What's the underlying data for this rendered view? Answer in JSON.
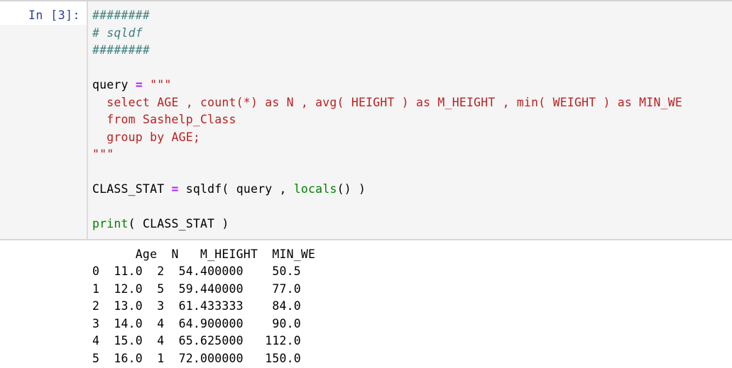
{
  "cell": {
    "prompt_label": "In [3]:",
    "execution_count": 3,
    "input_background": "#f5f5f5",
    "prompt_color": "#303f9f",
    "code_lines": [
      {
        "tokens": [
          {
            "text": "########",
            "type": "comment"
          }
        ]
      },
      {
        "tokens": [
          {
            "text": "# sqldf",
            "type": "comment"
          }
        ]
      },
      {
        "tokens": [
          {
            "text": "########",
            "type": "comment"
          }
        ]
      },
      {
        "tokens": []
      },
      {
        "tokens": [
          {
            "text": "query ",
            "type": "name"
          },
          {
            "text": "=",
            "type": "op"
          },
          {
            "text": " ",
            "type": "name"
          },
          {
            "text": "\"\"\"",
            "type": "string"
          }
        ]
      },
      {
        "tokens": [
          {
            "text": "  select AGE , count(*) as N , avg( HEIGHT ) as M_HEIGHT , min( WEIGHT ) as MIN_WE",
            "type": "string"
          }
        ]
      },
      {
        "tokens": [
          {
            "text": "  from Sashelp_Class",
            "type": "string"
          }
        ]
      },
      {
        "tokens": [
          {
            "text": "  group by AGE;",
            "type": "string"
          }
        ]
      },
      {
        "tokens": [
          {
            "text": "\"\"\"",
            "type": "string"
          }
        ]
      },
      {
        "tokens": []
      },
      {
        "tokens": [
          {
            "text": "CLASS_STAT ",
            "type": "name"
          },
          {
            "text": "=",
            "type": "op"
          },
          {
            "text": " sqldf( query , ",
            "type": "name"
          },
          {
            "text": "locals",
            "type": "builtin"
          },
          {
            "text": "() )",
            "type": "name"
          }
        ]
      },
      {
        "tokens": []
      },
      {
        "tokens": [
          {
            "text": "print",
            "type": "builtin"
          },
          {
            "text": "( CLASS_STAT )",
            "type": "name"
          }
        ]
      }
    ],
    "output": {
      "header_line": "      Age  N   M_HEIGHT  MIN_WE",
      "columns": [
        "",
        "Age",
        "N",
        "M_HEIGHT",
        "MIN_WE"
      ],
      "rows": [
        {
          "index": "0",
          "Age": "11.0",
          "N": "2",
          "M_HEIGHT": "54.400000",
          "MIN_WE": "50.5"
        },
        {
          "index": "1",
          "Age": "12.0",
          "N": "5",
          "M_HEIGHT": "59.440000",
          "MIN_WE": "77.0"
        },
        {
          "index": "2",
          "Age": "13.0",
          "N": "3",
          "M_HEIGHT": "61.433333",
          "MIN_WE": "84.0"
        },
        {
          "index": "3",
          "Age": "14.0",
          "N": "4",
          "M_HEIGHT": "64.900000",
          "MIN_WE": "90.0"
        },
        {
          "index": "4",
          "Age": "15.0",
          "N": "4",
          "M_HEIGHT": "65.625000",
          "MIN_WE": "112.0"
        },
        {
          "index": "5",
          "Age": "16.0",
          "N": "1",
          "M_HEIGHT": "72.000000",
          "MIN_WE": "150.0"
        }
      ],
      "text": "      Age  N   M_HEIGHT  MIN_WE\n0  11.0  2  54.400000    50.5\n1  12.0  5  59.440000    77.0\n2  13.0  3  61.433333    84.0\n3  14.0  4  64.900000    90.0\n4  15.0  4  65.625000   112.0\n5  16.0  1  72.000000   150.0"
    }
  }
}
